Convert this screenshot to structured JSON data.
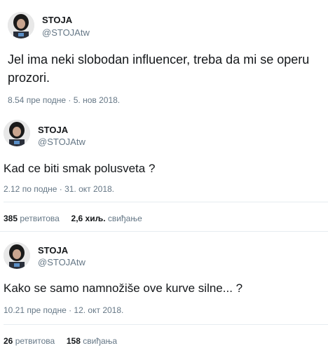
{
  "tweets": [
    {
      "name": "STOJA",
      "handle": "@STOJAtw",
      "text": "Jel ima neki slobodan influencer, treba da mi se operu prozori.",
      "timestamp": "8.54 пре подне · 5. нов 2018."
    },
    {
      "name": "STOJA",
      "handle": "@STOJAtw",
      "text": "Kad ce biti smak polusveta ?",
      "timestamp": "2.12 по подне · 31. окт 2018.",
      "retweets_count": "385",
      "retweets_label": "ретвитова",
      "likes_count": "2,6 хиљ.",
      "likes_label": "свиђање"
    },
    {
      "name": "STOJA",
      "handle": "@STOJAtw",
      "text": "Kako se samo namnožiše ove kurve silne... ?",
      "timestamp": "10.21 пре подне · 12. окт 2018.",
      "retweets_count": "26",
      "retweets_label": "ретвитова",
      "likes_count": "158",
      "likes_label": "свиђања"
    }
  ],
  "colors": {
    "text": "#14171a",
    "secondary": "#657786",
    "divider": "#e6ecf0"
  }
}
